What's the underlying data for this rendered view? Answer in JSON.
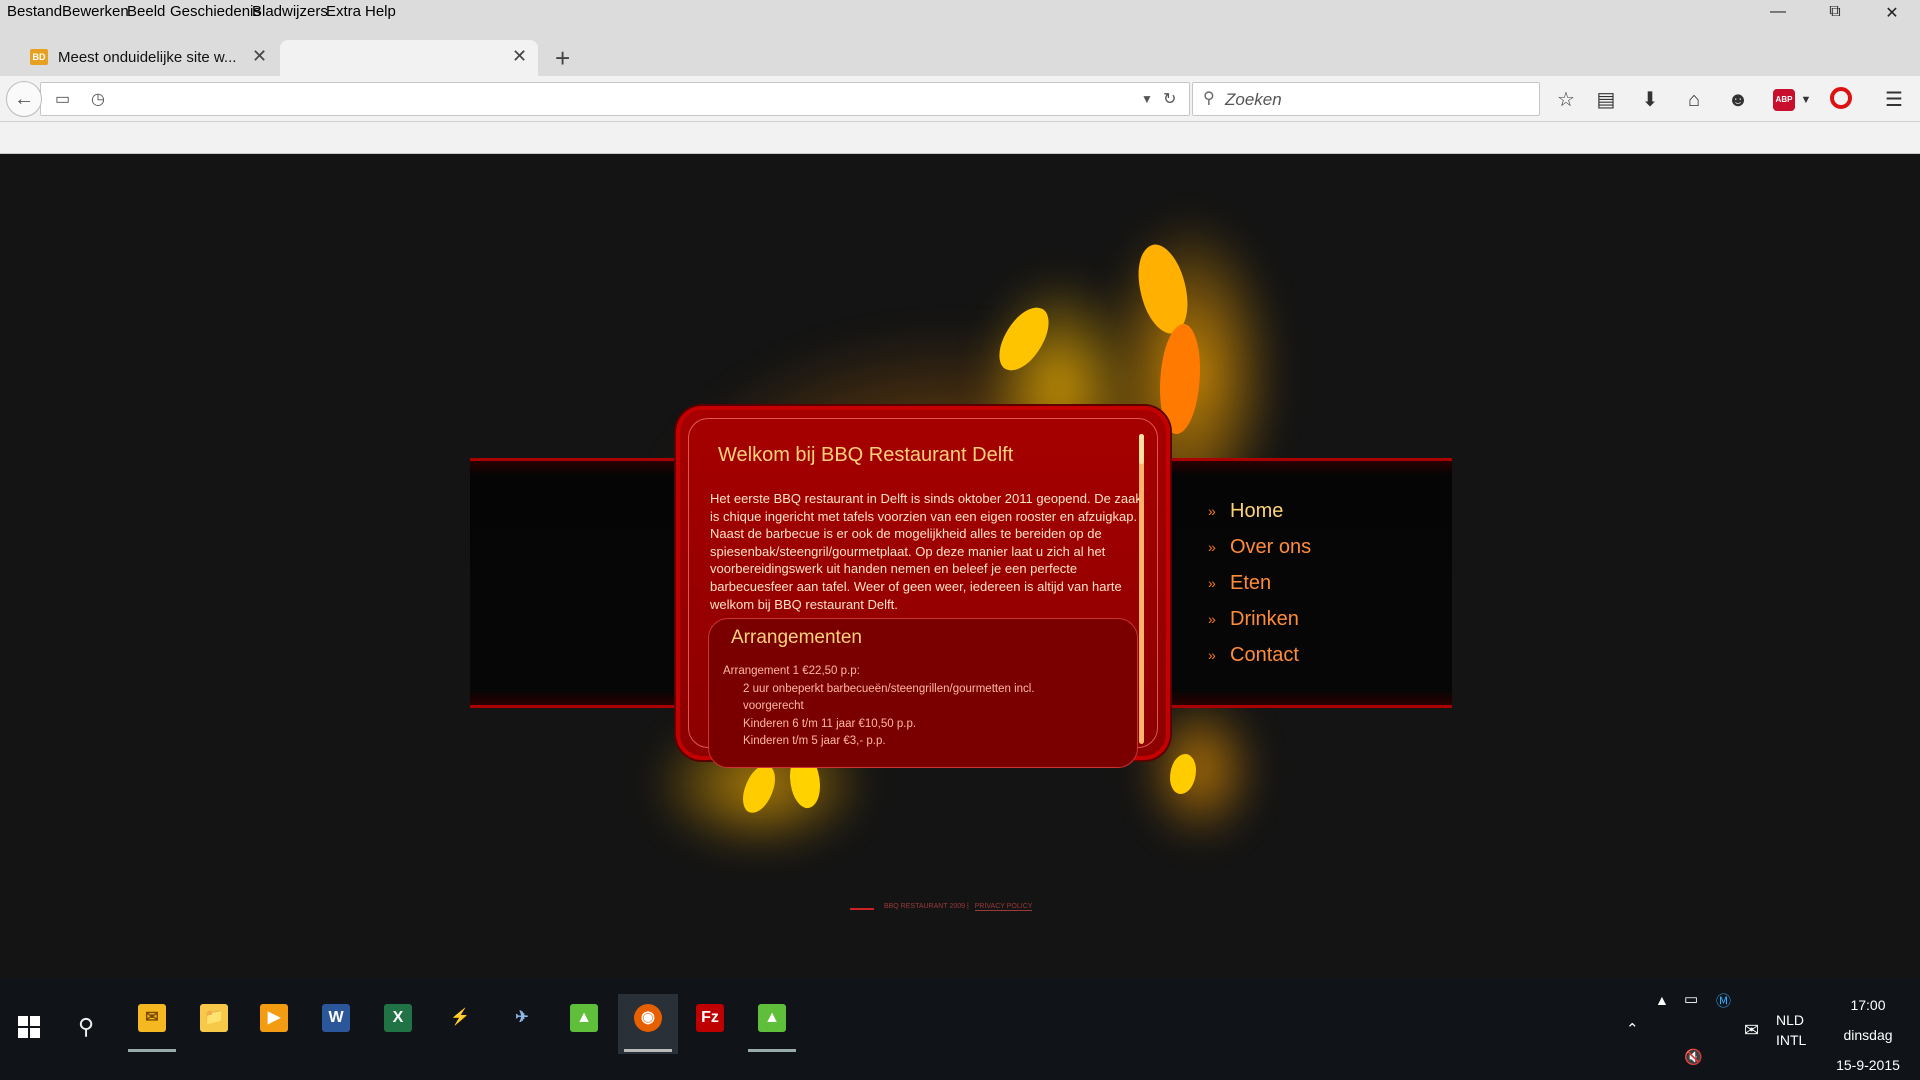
{
  "menubar": {
    "items": [
      "Bestand",
      "Bewerken",
      "Beeld",
      "Geschiedenis",
      "Bladwijzers",
      "Extra",
      "Help"
    ]
  },
  "window": {
    "minimize_icon": "minimize-icon",
    "restore_icon": "restore-icon",
    "close_icon": "close-icon"
  },
  "tabs": [
    {
      "title": "Meest onduidelijke site w...",
      "favicon": "site-favicon"
    },
    {
      "title": ""
    }
  ],
  "navbar": {
    "url": "",
    "search_placeholder": "Zoeken",
    "toolbar_icons": [
      "bookmark-star-icon",
      "reading-list-icon",
      "download-icon",
      "home-icon",
      "chat-icon",
      "adblock-icon",
      "opera-icon",
      "menu-icon"
    ],
    "abp_label": "ABP"
  },
  "page": {
    "welcome_title": "Welkom bij BBQ Restaurant Delft",
    "intro": "Het eerste BBQ restaurant in Delft is sinds oktober 2011 geopend. De zaak is chique ingericht met tafels voorzien van een eigen rooster en afzuigkap. Naast de barbecue is er ook de mogelijkheid alles te bereiden op de spiesenbak/steengril/gourmetplaat. Op deze manier laat u zich al het voorbereidingswerk uit handen nemen en beleef je een perfecte barbecuesfeer aan tafel. Weer of geen weer, iedereen is altijd van harte welkom bij BBQ restaurant Delft.",
    "arrangements_title": "Arrangementen",
    "arrangements": [
      {
        "text": "Arrangement 1 €22,50 p.p:",
        "sub": false
      },
      {
        "text": "2 uur onbeperkt barbecueën/steengrillen/gourmetten incl.",
        "sub": true
      },
      {
        "text": "voorgerecht",
        "sub": true
      },
      {
        "text": "Kinderen 6 t/m 11 jaar €10,50 p.p.",
        "sub": true
      },
      {
        "text": "Kinderen t/m 5 jaar €3,- p.p.",
        "sub": true
      }
    ],
    "nav": [
      "Home",
      "Over ons",
      "Eten",
      "Drinken",
      "Contact"
    ],
    "footer_text": "BBQ RESTAURANT 2009 |",
    "footer_link": "PRIVACY POLICY"
  },
  "taskbar": {
    "apps": [
      "outlook-icon",
      "file-explorer-icon",
      "media-player-icon",
      "word-icon",
      "excel-icon",
      "tool-icon",
      "network-icon",
      "bluestacks-icon",
      "firefox-icon",
      "filezilla-icon",
      "bluestacks-icon-2"
    ],
    "lang_line1": "NLD",
    "lang_line2": "INTL",
    "time": "17:00",
    "day": "dinsdag",
    "date": "15-9-2015"
  }
}
